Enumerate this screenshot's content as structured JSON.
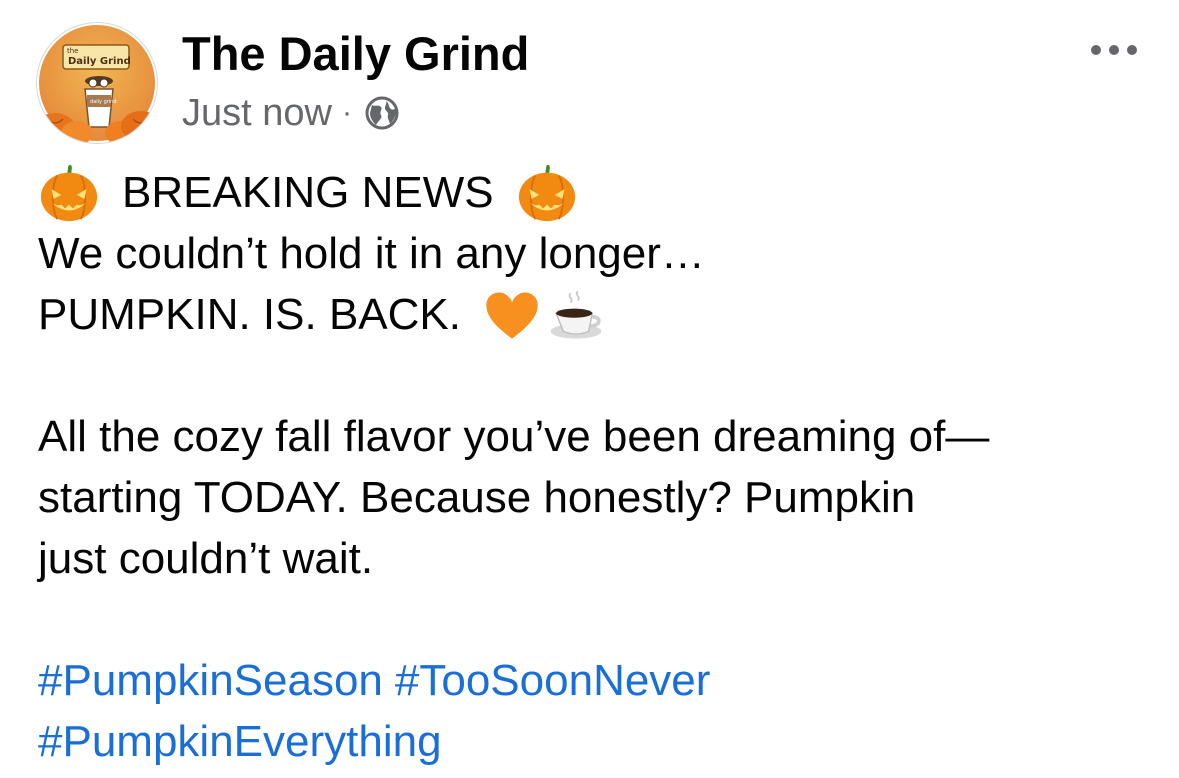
{
  "post": {
    "page_name": "The Daily Grind",
    "timestamp": "Just now",
    "separator": "·",
    "audience_icon": "globe-icon",
    "more_icon": "ellipsis-icon",
    "avatar_text": {
      "line1": "the",
      "line2": "Daily Grind",
      "cup_label": "daily grind"
    },
    "lines": {
      "l1": "BREAKING NEWS",
      "l2": "We couldn’t hold it in any longer…",
      "l3": "PUMPKIN. IS. BACK.",
      "l4": "All the cozy fall flavor you’ve been dreaming of—",
      "l5": "starting TODAY. Because honestly? Pumpkin",
      "l6": "just couldn’t wait."
    },
    "emojis": {
      "pumpkin": "jack-o-lantern-icon",
      "heart": "orange-heart-icon",
      "coffee": "hot-beverage-icon"
    },
    "hashtags": [
      "#PumpkinSeason",
      "#TooSoonNever",
      "#PumpkinEverything"
    ]
  },
  "colors": {
    "text": "#050505",
    "meta": "#65676b",
    "hashtag": "#1a6ed8",
    "pumpkin": "#f28a12",
    "heart": "#f7901e"
  }
}
